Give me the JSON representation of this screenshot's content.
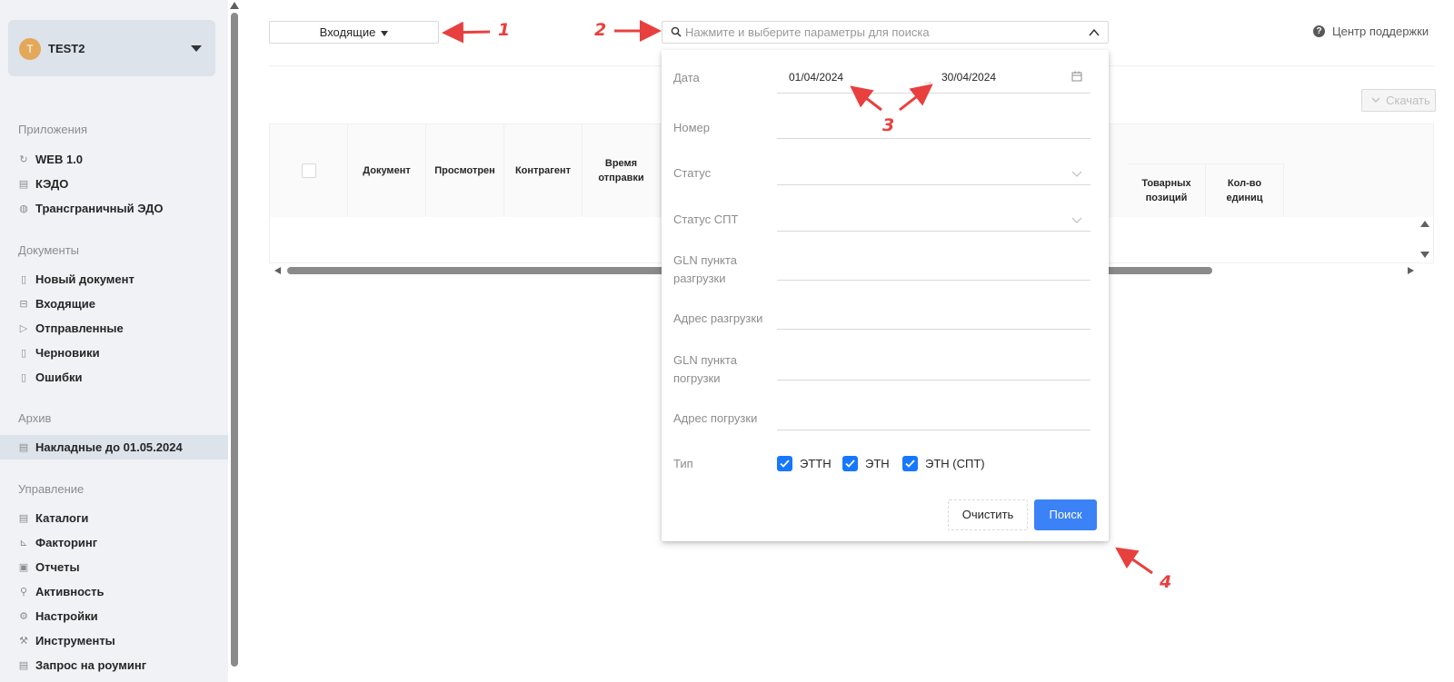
{
  "sidebar": {
    "account": {
      "initial": "T",
      "name": "TEST2"
    },
    "sections": [
      {
        "title": "Приложения",
        "items": [
          {
            "label": "WEB 1.0",
            "icon": "refresh-icon"
          },
          {
            "label": "КЭДО",
            "icon": "document-list-icon"
          },
          {
            "label": "Трансграничный ЭДО",
            "icon": "globe-icon"
          }
        ]
      },
      {
        "title": "Документы",
        "items": [
          {
            "label": "Новый документ",
            "icon": "file-plus-icon"
          },
          {
            "label": "Входящие",
            "icon": "inbox-icon"
          },
          {
            "label": "Отправленные",
            "icon": "send-icon"
          },
          {
            "label": "Черновики",
            "icon": "file-icon"
          },
          {
            "label": "Ошибки",
            "icon": "file-error-icon"
          }
        ]
      },
      {
        "title": "Архив",
        "items": [
          {
            "label": "Накладные до 01.05.2024",
            "icon": "archive-list-icon",
            "active": true
          }
        ]
      },
      {
        "title": "Управление",
        "items": [
          {
            "label": "Каталоги",
            "icon": "catalog-icon"
          },
          {
            "label": "Факторинг",
            "icon": "chart-icon"
          },
          {
            "label": "Отчеты",
            "icon": "report-icon"
          },
          {
            "label": "Активность",
            "icon": "search-icon"
          },
          {
            "label": "Настройки",
            "icon": "gear-icon"
          },
          {
            "label": "Инструменты",
            "icon": "wrench-icon"
          },
          {
            "label": "Запрос на роуминг",
            "icon": "request-icon"
          }
        ]
      }
    ]
  },
  "toolbar": {
    "folder_select": "Входящие",
    "search_placeholder": "Нажмите и выберите параметры для поиска",
    "support_label": "Центр поддержки",
    "download_label": "Скачать"
  },
  "table": {
    "columns": [
      "Документ",
      "Просмотрен",
      "Контрагент",
      "Время отправки"
    ],
    "right_columns": [
      "Товарных позиций",
      "Кол-во единиц"
    ]
  },
  "filter_panel": {
    "fields": {
      "date": "Дата",
      "date_from": "01/04/2024",
      "date_to": "30/04/2024",
      "number": "Номер",
      "status": "Статус",
      "status_spt": "Статус СПТ",
      "gln_unload": "GLN пункта разгрузки",
      "address_unload": "Адрес разгрузки",
      "gln_load": "GLN пункта погрузки",
      "address_load": "Адрес погрузки",
      "type": "Тип"
    },
    "types": [
      {
        "label": "ЭТТН",
        "checked": true
      },
      {
        "label": "ЭТН",
        "checked": true
      },
      {
        "label": "ЭТН (СПТ)",
        "checked": true
      }
    ],
    "clear_label": "Очистить",
    "search_label": "Поиск"
  },
  "annotations": [
    "1",
    "2",
    "3",
    "4"
  ],
  "colors": {
    "accent": "#3b82f6",
    "annotation": "#e8403f",
    "sidebar_bg": "#f0f2f5"
  }
}
